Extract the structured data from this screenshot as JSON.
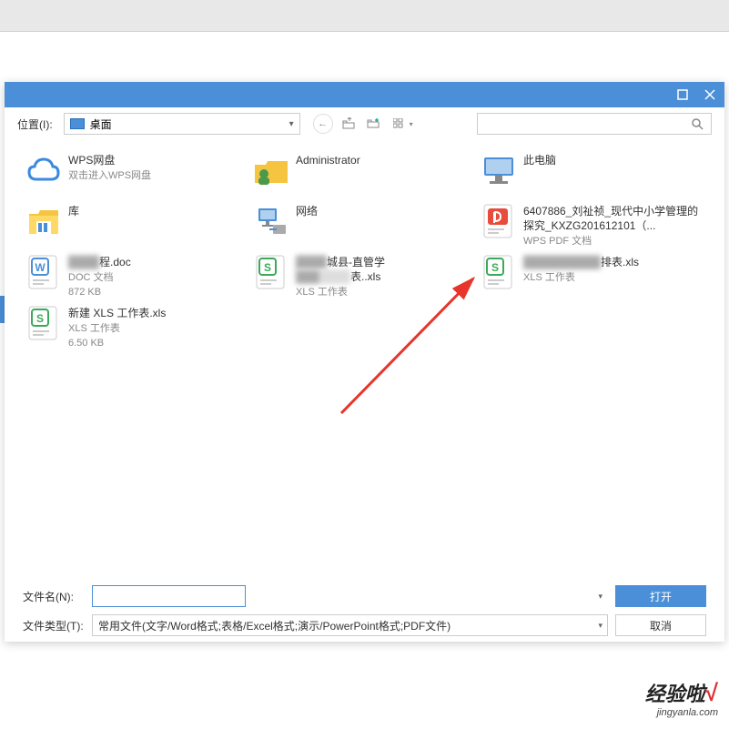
{
  "toolbar": {
    "location_label": "位置(I):",
    "location_value": "桌面"
  },
  "files": [
    {
      "name": "WPS网盘",
      "sub": "双击进入WPS网盘",
      "icon": "cloud"
    },
    {
      "name": "Administrator",
      "sub": "",
      "icon": "user"
    },
    {
      "name": "此电脑",
      "sub": "",
      "icon": "pc"
    },
    {
      "name": "库",
      "sub": "",
      "icon": "lib"
    },
    {
      "name": "网络",
      "sub": "",
      "icon": "net"
    },
    {
      "name": "6407886_刘祉祯_现代中小学管理的探究_KXZG201612101（...",
      "sub": "WPS PDF 文档",
      "icon": "pdf"
    },
    {
      "name": "程.doc",
      "blur_prefix": "████",
      "sub": "DOC 文档",
      "sub2": "872 KB",
      "icon": "doc"
    },
    {
      "name": "城县-直管学",
      "blur_prefix": "████",
      "blur_suffix": "表..xls",
      "sub": "XLS 工作表",
      "icon": "xls"
    },
    {
      "name": "排表.xls",
      "blur_prefix": "██████████",
      "sub": "XLS 工作表",
      "icon": "xls"
    },
    {
      "name": "新建 XLS 工作表.xls",
      "sub": "XLS 工作表",
      "sub2": "6.50 KB",
      "icon": "xls"
    }
  ],
  "bottom": {
    "filename_label": "文件名(N):",
    "filetype_label": "文件类型(T):",
    "filetype_value": "常用文件(文字/Word格式;表格/Excel格式;演示/PowerPoint格式;PDF文件)",
    "open": "打开",
    "cancel": "取消"
  },
  "watermark": {
    "big": "经验啦",
    "small": "jingyanla.com"
  }
}
